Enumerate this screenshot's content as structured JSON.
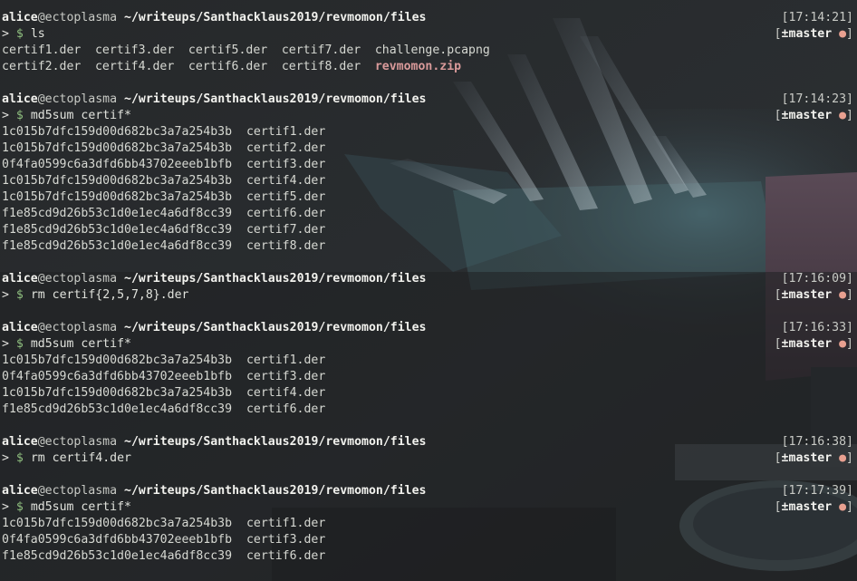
{
  "prompt": {
    "user": "alice",
    "at": "@",
    "host": "ectoplasma",
    "path": "~/writeups/Santhacklaus2019/revmomon/files",
    "caret": ">",
    "dollar": "$"
  },
  "git": {
    "open": "[",
    "plusminus": "±",
    "branch": "master",
    "dot": "●",
    "close": "]"
  },
  "blocks": [
    {
      "timestamp": "[17:14:21]",
      "command": "ls",
      "ls_rows": [
        [
          "certif1.der",
          "certif3.der",
          "certif5.der",
          "certif7.der",
          "challenge.pcapng"
        ],
        [
          "certif2.der",
          "certif4.der",
          "certif6.der",
          "certif8.der",
          "revmomon.zip"
        ]
      ]
    },
    {
      "timestamp": "[17:14:23]",
      "command": "md5sum certif*",
      "output": [
        "1c015b7dfc159d00d682bc3a7a254b3b  certif1.der",
        "1c015b7dfc159d00d682bc3a7a254b3b  certif2.der",
        "0f4fa0599c6a3dfd6bb43702eeeb1bfb  certif3.der",
        "1c015b7dfc159d00d682bc3a7a254b3b  certif4.der",
        "1c015b7dfc159d00d682bc3a7a254b3b  certif5.der",
        "f1e85cd9d26b53c1d0e1ec4a6df8cc39  certif6.der",
        "f1e85cd9d26b53c1d0e1ec4a6df8cc39  certif7.der",
        "f1e85cd9d26b53c1d0e1ec4a6df8cc39  certif8.der"
      ]
    },
    {
      "timestamp": "[17:16:09]",
      "command": "rm certif{2,5,7,8}.der",
      "output": []
    },
    {
      "timestamp": "[17:16:33]",
      "command": "md5sum certif*",
      "output": [
        "1c015b7dfc159d00d682bc3a7a254b3b  certif1.der",
        "0f4fa0599c6a3dfd6bb43702eeeb1bfb  certif3.der",
        "1c015b7dfc159d00d682bc3a7a254b3b  certif4.der",
        "f1e85cd9d26b53c1d0e1ec4a6df8cc39  certif6.der"
      ]
    },
    {
      "timestamp": "[17:16:38]",
      "command": "rm certif4.der",
      "output": []
    },
    {
      "timestamp": "[17:17:39]",
      "command": "md5sum certif*",
      "output": [
        "1c015b7dfc159d00d682bc3a7a254b3b  certif1.der",
        "0f4fa0599c6a3dfd6bb43702eeeb1bfb  certif3.der",
        "f1e85cd9d26b53c1d0e1ec4a6df8cc39  certif6.der"
      ]
    }
  ]
}
